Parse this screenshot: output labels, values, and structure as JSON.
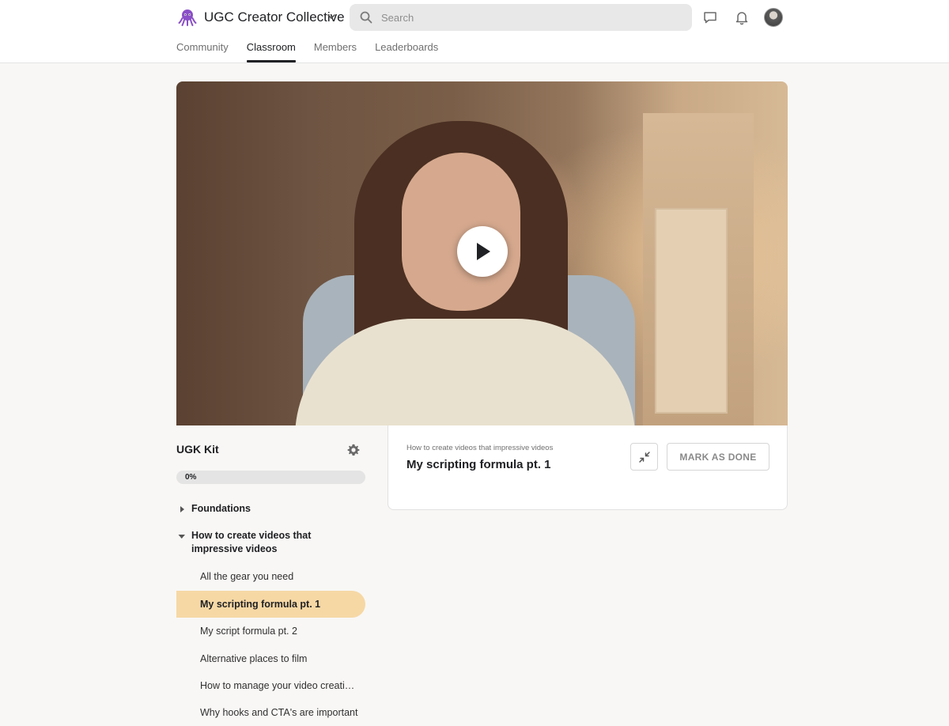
{
  "header": {
    "community_name": "UGC Creator Collective",
    "logo_icon": "octopus-icon",
    "search": {
      "placeholder": "Search",
      "value": ""
    },
    "icons": [
      "chevron-down-icon",
      "search-icon",
      "chat-icon",
      "bell-icon",
      "avatar"
    ]
  },
  "nav": {
    "tabs": [
      {
        "label": "Community",
        "active": false
      },
      {
        "label": "Classroom",
        "active": true
      },
      {
        "label": "Members",
        "active": false
      },
      {
        "label": "Leaderboards",
        "active": false
      }
    ]
  },
  "video": {
    "play_icon": "play-icon"
  },
  "course": {
    "title": "UGK Kit",
    "progress_label": "0%",
    "progress_fraction": 0,
    "sections": [
      {
        "label": "Foundations",
        "expanded": false
      },
      {
        "label": "How to create videos that impressive videos",
        "expanded": true
      }
    ],
    "lessons": [
      {
        "label": "All the gear you need",
        "active": false
      },
      {
        "label": "My scripting formula pt. 1",
        "active": true
      },
      {
        "label": "My script formula pt. 2",
        "active": false
      },
      {
        "label": "Alternative places to film",
        "active": false
      },
      {
        "label": "How to manage your video creation …",
        "active": false
      },
      {
        "label": "Why hooks and CTA's are important",
        "active": false
      }
    ]
  },
  "lesson_panel": {
    "breadcrumb": "How to create videos that impressive videos",
    "title": "My scripting formula pt. 1",
    "mark_done_label": "MARK AS DONE"
  },
  "colors": {
    "accent": "#f6d8a5",
    "background": "#f8f7f5",
    "logo": "#8a4fc7"
  }
}
